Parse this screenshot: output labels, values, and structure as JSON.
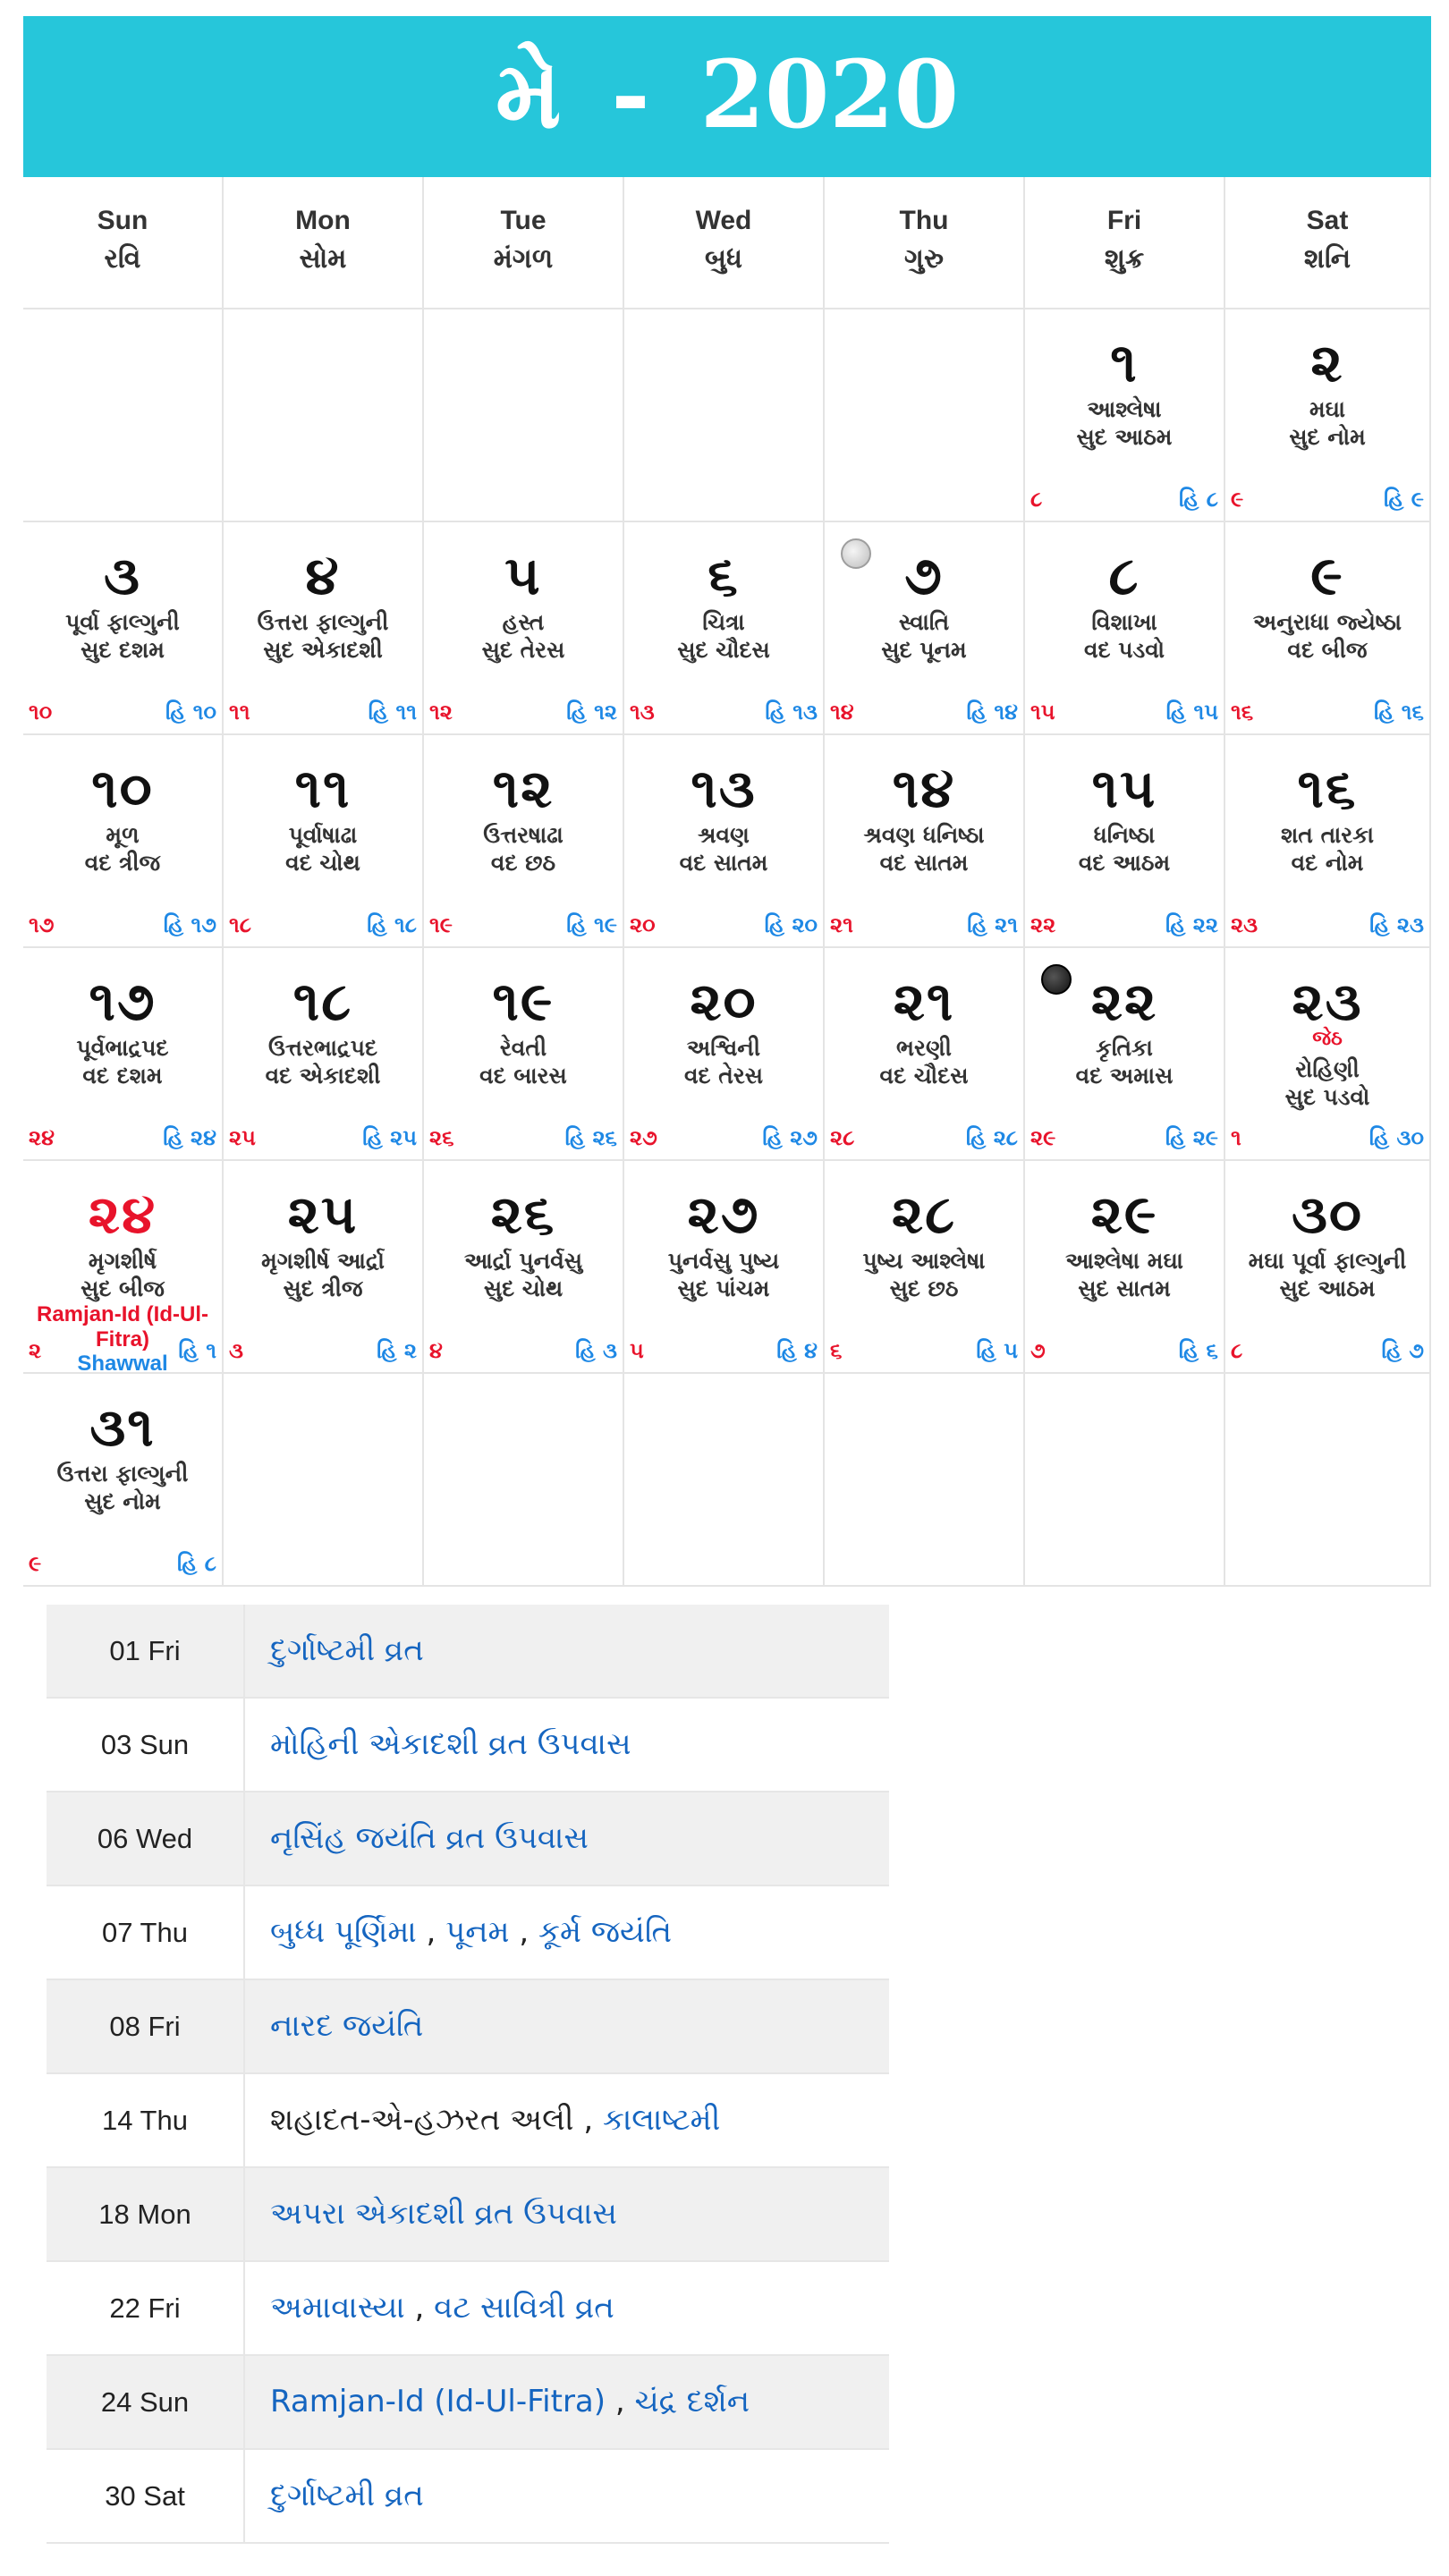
{
  "header": {
    "month": "મે",
    "separator": "-",
    "year": "2020"
  },
  "weekdays": [
    {
      "en": "Sun",
      "gu": "રવિ"
    },
    {
      "en": "Mon",
      "gu": "સોમ"
    },
    {
      "en": "Tue",
      "gu": "મંગળ"
    },
    {
      "en": "Wed",
      "gu": "બુધ"
    },
    {
      "en": "Thu",
      "gu": "ગુરુ"
    },
    {
      "en": "Fri",
      "gu": "શુક્ર"
    },
    {
      "en": "Sat",
      "gu": "શનિ"
    }
  ],
  "days": [
    {
      "row": 0,
      "col": 5,
      "num": "૧",
      "nak": "આશ્લેષા",
      "tithi": "સુદ આઠમ",
      "g": "૮",
      "h": "હિ ૮"
    },
    {
      "row": 0,
      "col": 6,
      "num": "૨",
      "nak": "મઘા",
      "tithi": "સુદ નોમ",
      "g": "૯",
      "h": "હિ ૯"
    },
    {
      "row": 1,
      "col": 0,
      "num": "૩",
      "nak": "પૂર્વા ફાલ્ગુની",
      "tithi": "સુદ દશમ",
      "g": "૧૦",
      "h": "હિ ૧૦"
    },
    {
      "row": 1,
      "col": 1,
      "num": "૪",
      "nak": "ઉત્તરા ફાલ્ગુની",
      "tithi": "સુદ એકાદશી",
      "g": "૧૧",
      "h": "હિ ૧૧"
    },
    {
      "row": 1,
      "col": 2,
      "num": "૫",
      "nak": "હસ્ત",
      "tithi": "સુદ તેરસ",
      "g": "૧૨",
      "h": "હિ ૧૨"
    },
    {
      "row": 1,
      "col": 3,
      "num": "૬",
      "nak": "ચિત્રા",
      "tithi": "સુદ ચૌદસ",
      "g": "૧૩",
      "h": "હિ ૧૩"
    },
    {
      "row": 1,
      "col": 4,
      "num": "૭",
      "nak": "સ્વાતિ",
      "tithi": "સુદ પૂનમ",
      "g": "૧૪",
      "h": "હિ ૧૪",
      "moon": "full"
    },
    {
      "row": 1,
      "col": 5,
      "num": "૮",
      "nak": "વિશાખા",
      "tithi": "વદ પડવો",
      "g": "૧૫",
      "h": "હિ ૧૫"
    },
    {
      "row": 1,
      "col": 6,
      "num": "૯",
      "nak": "અનુરાધા જ્યેષ્ઠા",
      "tithi": "વદ બીજ",
      "g": "૧૬",
      "h": "હિ ૧૬"
    },
    {
      "row": 2,
      "col": 0,
      "num": "૧૦",
      "nak": "મૂળ",
      "tithi": "વદ ત્રીજ",
      "g": "૧૭",
      "h": "હિ ૧૭"
    },
    {
      "row": 2,
      "col": 1,
      "num": "૧૧",
      "nak": "પૂર્વાષાઢા",
      "tithi": "વદ ચોથ",
      "g": "૧૮",
      "h": "હિ ૧૮"
    },
    {
      "row": 2,
      "col": 2,
      "num": "૧૨",
      "nak": "ઉત્તરષાઢા",
      "tithi": "વદ છઠ",
      "g": "૧૯",
      "h": "હિ ૧૯"
    },
    {
      "row": 2,
      "col": 3,
      "num": "૧૩",
      "nak": "શ્રવણ",
      "tithi": "વદ સાતમ",
      "g": "૨૦",
      "h": "હિ ૨૦"
    },
    {
      "row": 2,
      "col": 4,
      "num": "૧૪",
      "nak": "શ્રવણ ધનિષ્ઠા",
      "tithi": "વદ સાતમ",
      "g": "૨૧",
      "h": "હિ ૨૧"
    },
    {
      "row": 2,
      "col": 5,
      "num": "૧૫",
      "nak": "ધનિષ્ઠા",
      "tithi": "વદ આઠમ",
      "g": "૨૨",
      "h": "હિ ૨૨"
    },
    {
      "row": 2,
      "col": 6,
      "num": "૧૬",
      "nak": "શત તારકા",
      "tithi": "વદ નોમ",
      "g": "૨૩",
      "h": "હિ ૨૩"
    },
    {
      "row": 3,
      "col": 0,
      "num": "૧૭",
      "nak": "પૂર્વભાદ્રપદ",
      "tithi": "વદ દશમ",
      "g": "૨૪",
      "h": "હિ ૨૪"
    },
    {
      "row": 3,
      "col": 1,
      "num": "૧૮",
      "nak": "ઉત્તરભાદ્રપદ",
      "tithi": "વદ એકાદશી",
      "g": "૨૫",
      "h": "હિ ૨૫"
    },
    {
      "row": 3,
      "col": 2,
      "num": "૧૯",
      "nak": "રેવતી",
      "tithi": "વદ બારસ",
      "g": "૨૬",
      "h": "હિ ૨૬"
    },
    {
      "row": 3,
      "col": 3,
      "num": "૨૦",
      "nak": "અશ્વિની",
      "tithi": "વદ તેરસ",
      "g": "૨૭",
      "h": "હિ ૨૭"
    },
    {
      "row": 3,
      "col": 4,
      "num": "૨૧",
      "nak": "ભરણી",
      "tithi": "વદ ચૌદસ",
      "g": "૨૮",
      "h": "હિ ૨૮"
    },
    {
      "row": 3,
      "col": 5,
      "num": "૨૨",
      "nak": "કૃતિકા",
      "tithi": "વદ અમાસ",
      "g": "૨૯",
      "h": "હિ ૨૯",
      "moon": "new"
    },
    {
      "row": 3,
      "col": 6,
      "num": "૨૩",
      "jeth": "જેઠ",
      "nak": "રોહિણી",
      "tithi": "સુદ પડવો",
      "g": "૧",
      "h": "હિ ૩૦"
    },
    {
      "row": 4,
      "col": 0,
      "num": "૨૪",
      "sun": true,
      "nak": "મૃગશીર્ષ",
      "tithi": "સુદ બીજ",
      "fest": "Ramjan-Id (Id-Ul-Fitra)",
      "month": "Shawwal",
      "g": "૨",
      "h": "હિ ૧"
    },
    {
      "row": 4,
      "col": 1,
      "num": "૨૫",
      "nak": "મૃગશીર્ષ આર્દ્રા",
      "tithi": "સુદ ત્રીજ",
      "g": "૩",
      "h": "હિ ૨"
    },
    {
      "row": 4,
      "col": 2,
      "num": "૨૬",
      "nak": "આર્દ્રા પુનર્વસુ",
      "tithi": "સુદ ચોથ",
      "g": "૪",
      "h": "હિ ૩"
    },
    {
      "row": 4,
      "col": 3,
      "num": "૨૭",
      "nak": "પુનર્વસુ પુષ્ય",
      "tithi": "સુદ પાંચમ",
      "g": "૫",
      "h": "હિ ૪"
    },
    {
      "row": 4,
      "col": 4,
      "num": "૨૮",
      "nak": "પુષ્ય આશ્લેષા",
      "tithi": "સુદ છઠ",
      "g": "૬",
      "h": "હિ ૫"
    },
    {
      "row": 4,
      "col": 5,
      "num": "૨૯",
      "nak": "આશ્લેષા મઘા",
      "tithi": "સુદ સાતમ",
      "g": "૭",
      "h": "હિ ૬"
    },
    {
      "row": 4,
      "col": 6,
      "num": "૩૦",
      "nak": "મઘા પૂર્વા ફાલ્ગુની",
      "tithi": "સુદ આઠમ",
      "g": "૮",
      "h": "હિ ૭"
    },
    {
      "row": 5,
      "col": 0,
      "num": "૩૧",
      "nak": "ઉત્તરા ફાલ્ગુની",
      "tithi": "સુદ નોમ",
      "g": "૯",
      "h": "હિ ૮"
    }
  ],
  "events": [
    {
      "date": "01 Fri",
      "items": [
        {
          "text": "દુર્ગાષ્ટમી વ્રત",
          "link": true
        }
      ]
    },
    {
      "date": "03 Sun",
      "items": [
        {
          "text": "મોહિની એકાદશી વ્રત ઉપવાસ",
          "link": true
        }
      ]
    },
    {
      "date": "06 Wed",
      "items": [
        {
          "text": "નૃસિંહ જયંતિ વ્રત ઉપવાસ",
          "link": true
        }
      ]
    },
    {
      "date": "07 Thu",
      "items": [
        {
          "text": "બુધ્ધ પૂર્ણિમા",
          "link": true
        },
        {
          "text": "પૂનમ",
          "link": true
        },
        {
          "text": "કૂર્મ જયંતિ",
          "link": true
        }
      ]
    },
    {
      "date": "08 Fri",
      "items": [
        {
          "text": "નારદ જયંતિ",
          "link": true
        }
      ]
    },
    {
      "date": "14 Thu",
      "items": [
        {
          "text": "શહાદત-એ-હઝરત અલી",
          "link": false
        },
        {
          "text": "કાલાષ્ટમી",
          "link": true
        }
      ]
    },
    {
      "date": "18 Mon",
      "items": [
        {
          "text": "અપરા એકાદશી વ્રત ઉપવાસ",
          "link": true
        }
      ]
    },
    {
      "date": "22 Fri",
      "items": [
        {
          "text": "અમાવાસ્યા",
          "link": true
        },
        {
          "text": "વટ સાવિત્રી વ્રત",
          "link": true
        }
      ]
    },
    {
      "date": "24 Sun",
      "items": [
        {
          "text": "Ramjan-Id (Id-Ul-Fitra)",
          "link": true
        },
        {
          "text": "ચંદ્ર દર્શન",
          "link": true
        }
      ]
    },
    {
      "date": "30 Sat",
      "items": [
        {
          "text": "દુર્ગાષ્ટમી વ્રત",
          "link": true
        }
      ]
    }
  ],
  "colors": {
    "header_bg": "#26c6da",
    "sunday_red": "#e8132b",
    "hijri_blue": "#1e88e5",
    "link_blue": "#1565c0"
  }
}
